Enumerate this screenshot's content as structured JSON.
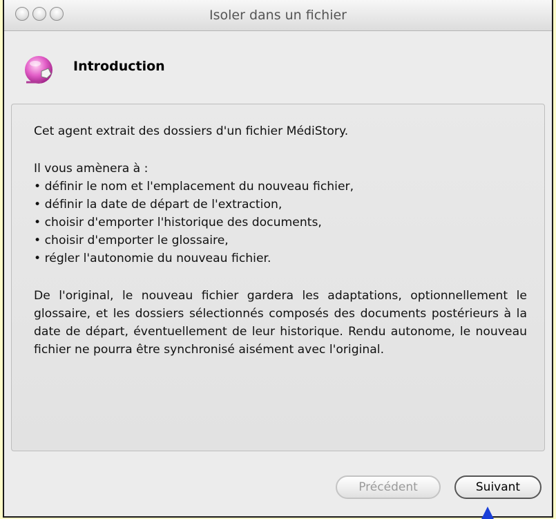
{
  "window": {
    "title": "Isoler dans un fichier"
  },
  "header": {
    "title": "Introduction",
    "icon": "app-pink-sphere-icon"
  },
  "content": {
    "intro": "Cet agent extrait des dossiers d'un fichier MédiStory.",
    "list_intro": "Il vous amènera à :",
    "bullets": [
      "définir le nom et l'emplacement du nouveau fichier,",
      "définir la date de départ de l'extraction,",
      "choisir d'emporter l'historique des documents,",
      "choisir d'emporter le glossaire,",
      "régler l'autonomie du nouveau fichier."
    ],
    "paragraph": "De l'original, le nouveau fichier gardera les adaptations, optionnellement le glossaire, et les dossiers sélectionnés composés des documents postérieurs à la date de départ, éventuellement de leur historique. Rendu autonome, le nouveau fichier ne pourra être synchronisé aisément avec l'original."
  },
  "buttons": {
    "previous": "Précédent",
    "next": "Suivant"
  },
  "colors": {
    "background": "#fefcc8",
    "window": "#ececec",
    "pointer": "#1a3fd8"
  }
}
